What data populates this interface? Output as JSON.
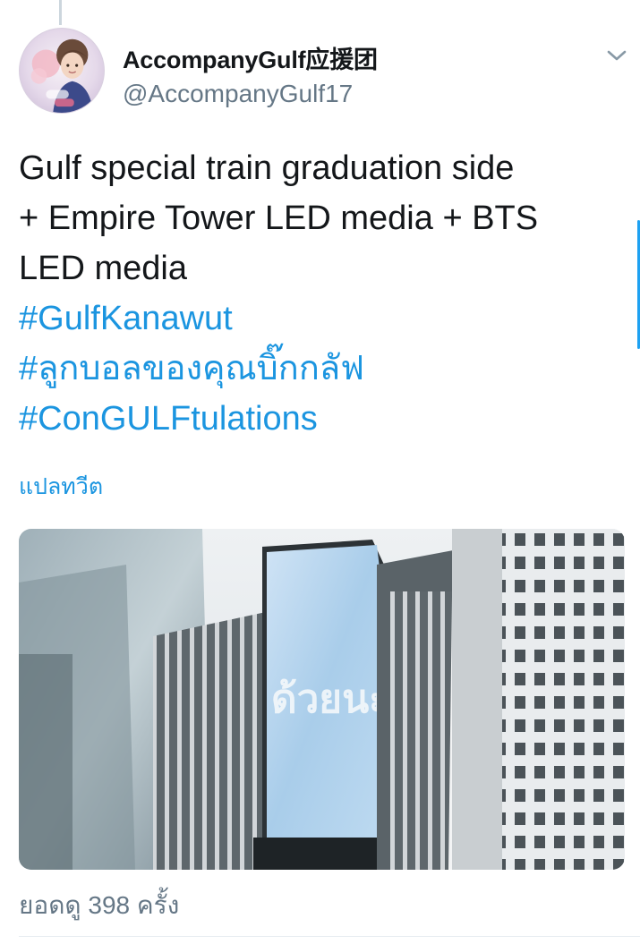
{
  "author": {
    "display_name": "AccompanyGulf应援团",
    "handle": "@AccompanyGulf17",
    "avatar_icon": "profile-avatar"
  },
  "tweet": {
    "text_lines": [
      "Gulf special train graduation side",
      "+ Empire Tower LED media + BTS",
      "LED media"
    ],
    "hashtags": [
      "#GulfKanawut",
      "#ลูกบอลของคุณบิ๊กกลัฟ",
      "#ConGULFtulations"
    ],
    "translate_label": "แปลทวีต"
  },
  "media": {
    "screen_text": "ด้วยนะ"
  },
  "stats": {
    "views_label": "ยอดดู 398 ครั้ง"
  },
  "colors": {
    "link": "#1b95e0",
    "secondary_text": "#657786",
    "primary_text": "#14171a",
    "scroll_indicator": "#1da1f2"
  },
  "icons": {
    "menu": "chevron-down-icon"
  }
}
